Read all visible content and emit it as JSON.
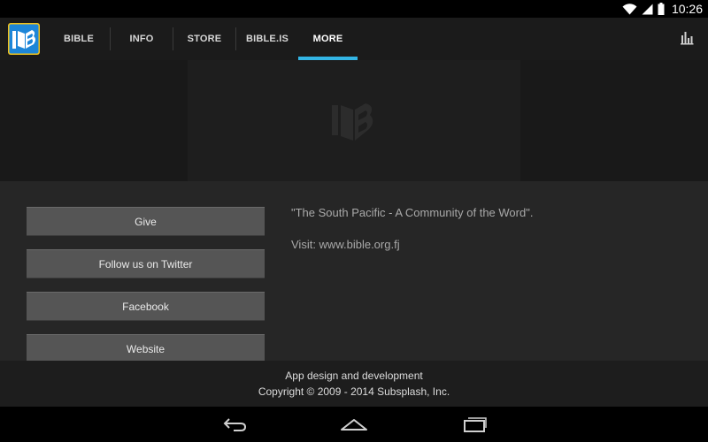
{
  "status_bar": {
    "time": "10:26",
    "icons": [
      "wifi-icon",
      "signal-icon",
      "battery-icon"
    ]
  },
  "action_bar": {
    "logo_icon": "bible-app-logo",
    "tabs": [
      {
        "label": "BIBLE",
        "active": false
      },
      {
        "label": "INFO",
        "active": false
      },
      {
        "label": "STORE",
        "active": false
      },
      {
        "label": "BIBLE.IS",
        "active": false
      },
      {
        "label": "MORE",
        "active": true
      }
    ],
    "stats_icon": "bar-chart-icon",
    "accent_color": "#33b5e5"
  },
  "banner": {
    "logo_icon": "bible-logo-watermark"
  },
  "buttons": {
    "give": "Give",
    "twitter": "Follow us on Twitter",
    "facebook": "Facebook",
    "website": "Website"
  },
  "info": {
    "quote": "\"The South Pacific - A Community of the Word\".",
    "visit": "Visit: www.bible.org.fj"
  },
  "footer": {
    "line1": "App design and development",
    "line2": "Copyright © 2009 - 2014 Subsplash, Inc."
  },
  "nav_bar": {
    "icons": [
      "back-icon",
      "home-icon",
      "recent-apps-icon"
    ]
  }
}
